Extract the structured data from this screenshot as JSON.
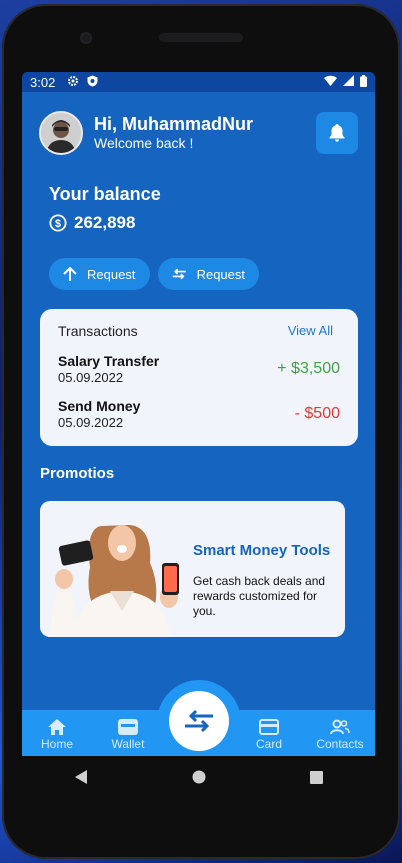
{
  "status": {
    "time": "3:02"
  },
  "header": {
    "greeting": "Hi, MuhammadNur",
    "subtitle": "Welcome back !"
  },
  "balance": {
    "label": "Your balance",
    "amount": "262,898"
  },
  "actions": [
    {
      "label": "Request"
    },
    {
      "label": "Request"
    }
  ],
  "transactions": {
    "title": "Transactions",
    "view_all": "View All",
    "items": [
      {
        "name": "Salary Transfer",
        "date": "05.09.2022",
        "amount": "+ $3,500",
        "color": "#43a047"
      },
      {
        "name": "Send Money",
        "date": "05.09.2022",
        "amount": "- $500",
        "color": "#e53935"
      }
    ]
  },
  "promotions": {
    "title": "Promotios",
    "card_title": "Smart Money Tools",
    "card_text": "Get cash back deals and rewards customized for you."
  },
  "nav": {
    "home": "Home",
    "wallet": "Wallet",
    "card": "Card",
    "contacts": "Contacts"
  },
  "icons": [
    "gear-icon",
    "shield-icon",
    "wifi-icon",
    "signal-icon",
    "battery-icon",
    "bell-icon",
    "dollar-icon",
    "arrow-up-icon",
    "swap-icon",
    "home-icon",
    "wallet-icon",
    "card-icon",
    "contacts-icon",
    "back-icon",
    "home-circle-icon",
    "recents-icon"
  ]
}
